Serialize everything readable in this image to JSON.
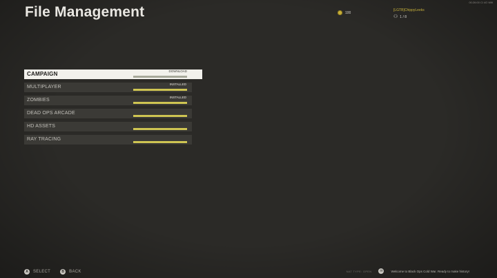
{
  "header": {
    "title": "File Management",
    "clock": "00:26:00 Cl 4G Wifi"
  },
  "currency": {
    "value": "100",
    "icon": "coin-icon"
  },
  "player": {
    "name": "[LGTB]ChippyLeeks",
    "party": "1 / 8",
    "icon": "party-icon"
  },
  "menu": {
    "items": [
      {
        "label": "CAMPAIGN",
        "status": "DOWNLOAD",
        "progress": 0.0,
        "selected": true
      },
      {
        "label": "MULTIPLAYER",
        "status": "INSTALLED",
        "progress": 1.0,
        "selected": false
      },
      {
        "label": "ZOMBIES",
        "status": "INSTALLED",
        "progress": 1.0,
        "selected": false
      },
      {
        "label": "DEAD OPS ARCADE",
        "status": "",
        "progress": 1.0,
        "selected": false
      },
      {
        "label": "HD ASSETS",
        "status": "",
        "progress": 1.0,
        "selected": false
      },
      {
        "label": "RAY TRACING",
        "status": "",
        "progress": 1.0,
        "selected": false
      }
    ]
  },
  "footer": {
    "select_glyph": "A",
    "select_label": "SELECT",
    "back_glyph": "B",
    "back_label": "BACK",
    "net_status": "NAT TYPE: OPEN",
    "message": "Welcome to Black Ops Cold War. Ready to make history!"
  },
  "colors": {
    "accent": "#cfc552",
    "background": "#2b2a27"
  }
}
